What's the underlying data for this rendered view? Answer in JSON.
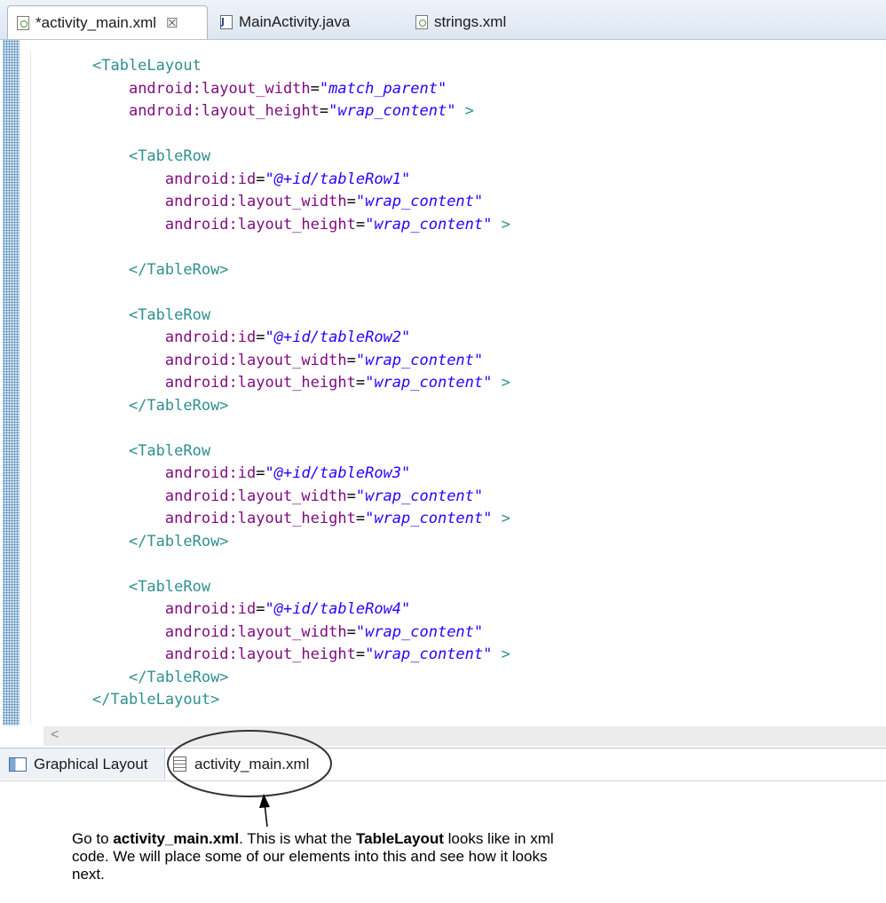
{
  "editor_tabs": [
    {
      "label": "*activity_main.xml",
      "icon": "xml-file-icon",
      "active": true,
      "close": "☒"
    },
    {
      "label": "MainActivity.java",
      "icon": "java-file-icon",
      "active": false
    },
    {
      "label": "strings.xml",
      "icon": "xml-file-icon",
      "active": false
    }
  ],
  "code_lines": [
    [
      [
        "tag",
        "<TableLayout"
      ]
    ],
    [
      [
        "indent",
        "    "
      ],
      [
        "attr",
        "android:layout_width"
      ],
      [
        "eq",
        "="
      ],
      [
        "val",
        "\"match_parent\""
      ]
    ],
    [
      [
        "indent",
        "    "
      ],
      [
        "attr",
        "android:layout_height"
      ],
      [
        "eq",
        "="
      ],
      [
        "val",
        "\"wrap_content\""
      ],
      [
        "tag",
        " >"
      ]
    ],
    [],
    [
      [
        "indent",
        "    "
      ],
      [
        "tag",
        "<TableRow"
      ]
    ],
    [
      [
        "indent",
        "        "
      ],
      [
        "attr",
        "android:id"
      ],
      [
        "eq",
        "="
      ],
      [
        "val",
        "\"@+id/tableRow1\""
      ]
    ],
    [
      [
        "indent",
        "        "
      ],
      [
        "attr",
        "android:layout_width"
      ],
      [
        "eq",
        "="
      ],
      [
        "val",
        "\"wrap_content\""
      ]
    ],
    [
      [
        "indent",
        "        "
      ],
      [
        "attr",
        "android:layout_height"
      ],
      [
        "eq",
        "="
      ],
      [
        "val",
        "\"wrap_content\""
      ],
      [
        "tag",
        " >"
      ]
    ],
    [],
    [
      [
        "indent",
        "    "
      ],
      [
        "tag",
        "</TableRow>"
      ]
    ],
    [],
    [
      [
        "indent",
        "    "
      ],
      [
        "tag",
        "<TableRow"
      ]
    ],
    [
      [
        "indent",
        "        "
      ],
      [
        "attr",
        "android:id"
      ],
      [
        "eq",
        "="
      ],
      [
        "val",
        "\"@+id/tableRow2\""
      ]
    ],
    [
      [
        "indent",
        "        "
      ],
      [
        "attr",
        "android:layout_width"
      ],
      [
        "eq",
        "="
      ],
      [
        "val",
        "\"wrap_content\""
      ]
    ],
    [
      [
        "indent",
        "        "
      ],
      [
        "attr",
        "android:layout_height"
      ],
      [
        "eq",
        "="
      ],
      [
        "val",
        "\"wrap_content\""
      ],
      [
        "tag",
        " >"
      ]
    ],
    [
      [
        "indent",
        "    "
      ],
      [
        "tag",
        "</TableRow>"
      ]
    ],
    [],
    [
      [
        "indent",
        "    "
      ],
      [
        "tag",
        "<TableRow"
      ]
    ],
    [
      [
        "indent",
        "        "
      ],
      [
        "attr",
        "android:id"
      ],
      [
        "eq",
        "="
      ],
      [
        "val",
        "\"@+id/tableRow3\""
      ]
    ],
    [
      [
        "indent",
        "        "
      ],
      [
        "attr",
        "android:layout_width"
      ],
      [
        "eq",
        "="
      ],
      [
        "val",
        "\"wrap_content\""
      ]
    ],
    [
      [
        "indent",
        "        "
      ],
      [
        "attr",
        "android:layout_height"
      ],
      [
        "eq",
        "="
      ],
      [
        "val",
        "\"wrap_content\""
      ],
      [
        "tag",
        " >"
      ]
    ],
    [
      [
        "indent",
        "    "
      ],
      [
        "tag",
        "</TableRow>"
      ]
    ],
    [],
    [
      [
        "indent",
        "    "
      ],
      [
        "tag",
        "<TableRow"
      ]
    ],
    [
      [
        "indent",
        "        "
      ],
      [
        "attr",
        "android:id"
      ],
      [
        "eq",
        "="
      ],
      [
        "val",
        "\"@+id/tableRow4\""
      ]
    ],
    [
      [
        "indent",
        "        "
      ],
      [
        "attr",
        "android:layout_width"
      ],
      [
        "eq",
        "="
      ],
      [
        "val",
        "\"wrap_content\""
      ]
    ],
    [
      [
        "indent",
        "        "
      ],
      [
        "attr",
        "android:layout_height"
      ],
      [
        "eq",
        "="
      ],
      [
        "val",
        "\"wrap_content\""
      ],
      [
        "tag",
        " >"
      ]
    ],
    [
      [
        "indent",
        "    "
      ],
      [
        "tag",
        "</TableRow>"
      ]
    ],
    [
      [
        "tag",
        "</TableLayout>"
      ]
    ]
  ],
  "scrollbar": {
    "left_arrow": "<"
  },
  "bottom_tabs": [
    {
      "label": "Graphical Layout",
      "icon": "graphical-layout-icon",
      "active": false
    },
    {
      "label": "activity_main.xml",
      "icon": "xml-source-icon",
      "active": true
    }
  ],
  "caption": {
    "part1": "Go to ",
    "bold1": "activity_main.xml",
    "part2": ". This is what the ",
    "bold2": "TableLayout",
    "part3": " looks like in xml code. We will place some of our elements into this and see how it looks next."
  },
  "colors": {
    "tag": "#2f8f8f",
    "attribute": "#7f0a7f",
    "value": "#2a00ff",
    "callout_outline": "#333333"
  }
}
